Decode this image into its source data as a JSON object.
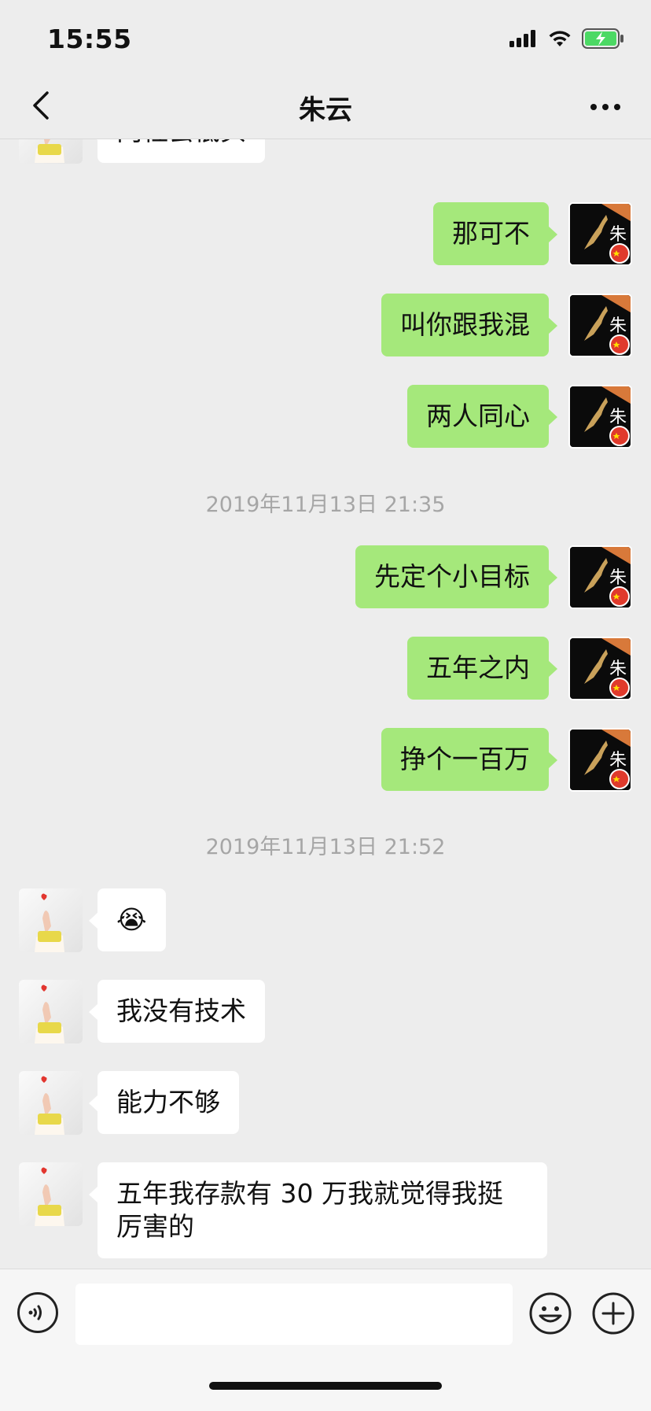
{
  "status": {
    "time": "15:55"
  },
  "header": {
    "title": "朱云"
  },
  "messages": [
    {
      "side": "left",
      "text": "向社会低头"
    },
    {
      "side": "right",
      "text": "那可不"
    },
    {
      "side": "right",
      "text": "叫你跟我混"
    },
    {
      "side": "right",
      "text": "两人同心"
    },
    {
      "timestamp": "2019年11月13日 21:35"
    },
    {
      "side": "right",
      "text": "先定个小目标"
    },
    {
      "side": "right",
      "text": "五年之内"
    },
    {
      "side": "right",
      "text": "挣个一百万"
    },
    {
      "timestamp": "2019年11月13日 21:52"
    },
    {
      "side": "left",
      "text": "😭"
    },
    {
      "side": "left",
      "text": "我没有技术"
    },
    {
      "side": "left",
      "text": "能力不够"
    },
    {
      "side": "left",
      "text": "五年我存款有 30 万我就觉得我挺\n厉害的"
    }
  ],
  "avatars": {
    "left": "finger-heart-hand-avatar",
    "right": "jordan-logo-avatar-with-china-flag-badge",
    "right_avatar_glyph": "朱"
  },
  "input": {
    "placeholder": ""
  },
  "colors": {
    "bubble_sent": "#a5e87b",
    "bubble_received": "#ffffff",
    "background": "#ededed",
    "timestamp": "#a6a6a6"
  }
}
